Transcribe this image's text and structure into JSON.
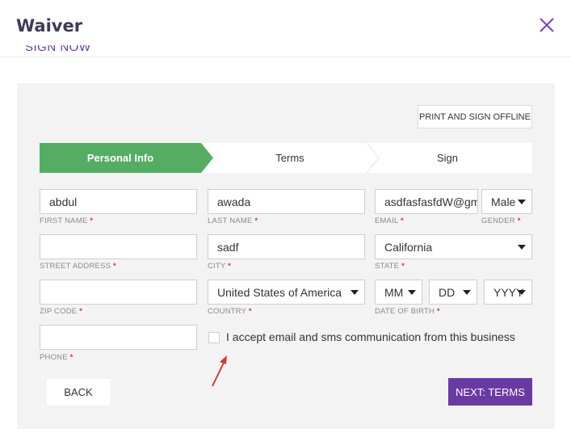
{
  "modal": {
    "title": "Waiver",
    "subtitle": "SIGN NOW"
  },
  "print_button": "PRINT AND SIGN OFFLINE",
  "steps": [
    {
      "label": "Personal Info",
      "active": true
    },
    {
      "label": "Terms",
      "active": false
    },
    {
      "label": "Sign",
      "active": false
    }
  ],
  "form": {
    "first_name": {
      "value": "abdul",
      "label": "FIRST NAME"
    },
    "last_name": {
      "value": "awada",
      "label": "LAST NAME"
    },
    "email": {
      "value": "asdfasfasfdW@gmail.com",
      "label": "EMAIL"
    },
    "gender": {
      "value": "Male",
      "label": "GENDER"
    },
    "street_address": {
      "value": "",
      "label": "STREET ADDRESS"
    },
    "city": {
      "value": "sadf",
      "label": "CITY"
    },
    "state": {
      "value": "California",
      "label": "STATE"
    },
    "zip_code": {
      "value": "",
      "label": "ZIP CODE"
    },
    "country": {
      "value": "United States of America",
      "label": "COUNTRY"
    },
    "dob": {
      "month": "MM",
      "day": "DD",
      "year": "YYYY",
      "label": "DATE OF BIRTH"
    },
    "phone": {
      "value": "",
      "label": "PHONE"
    },
    "required_marker": "*",
    "consent_label": "I accept email and sms communication from this business",
    "consent_checked": false
  },
  "buttons": {
    "back": "BACK",
    "next": "NEXT: TERMS"
  },
  "colors": {
    "accent": "#6a3aa3",
    "step_active": "#55ad63",
    "panel": "#f3f3f3",
    "required": "#d9363e",
    "annotation_arrow": "#d23b2f"
  }
}
